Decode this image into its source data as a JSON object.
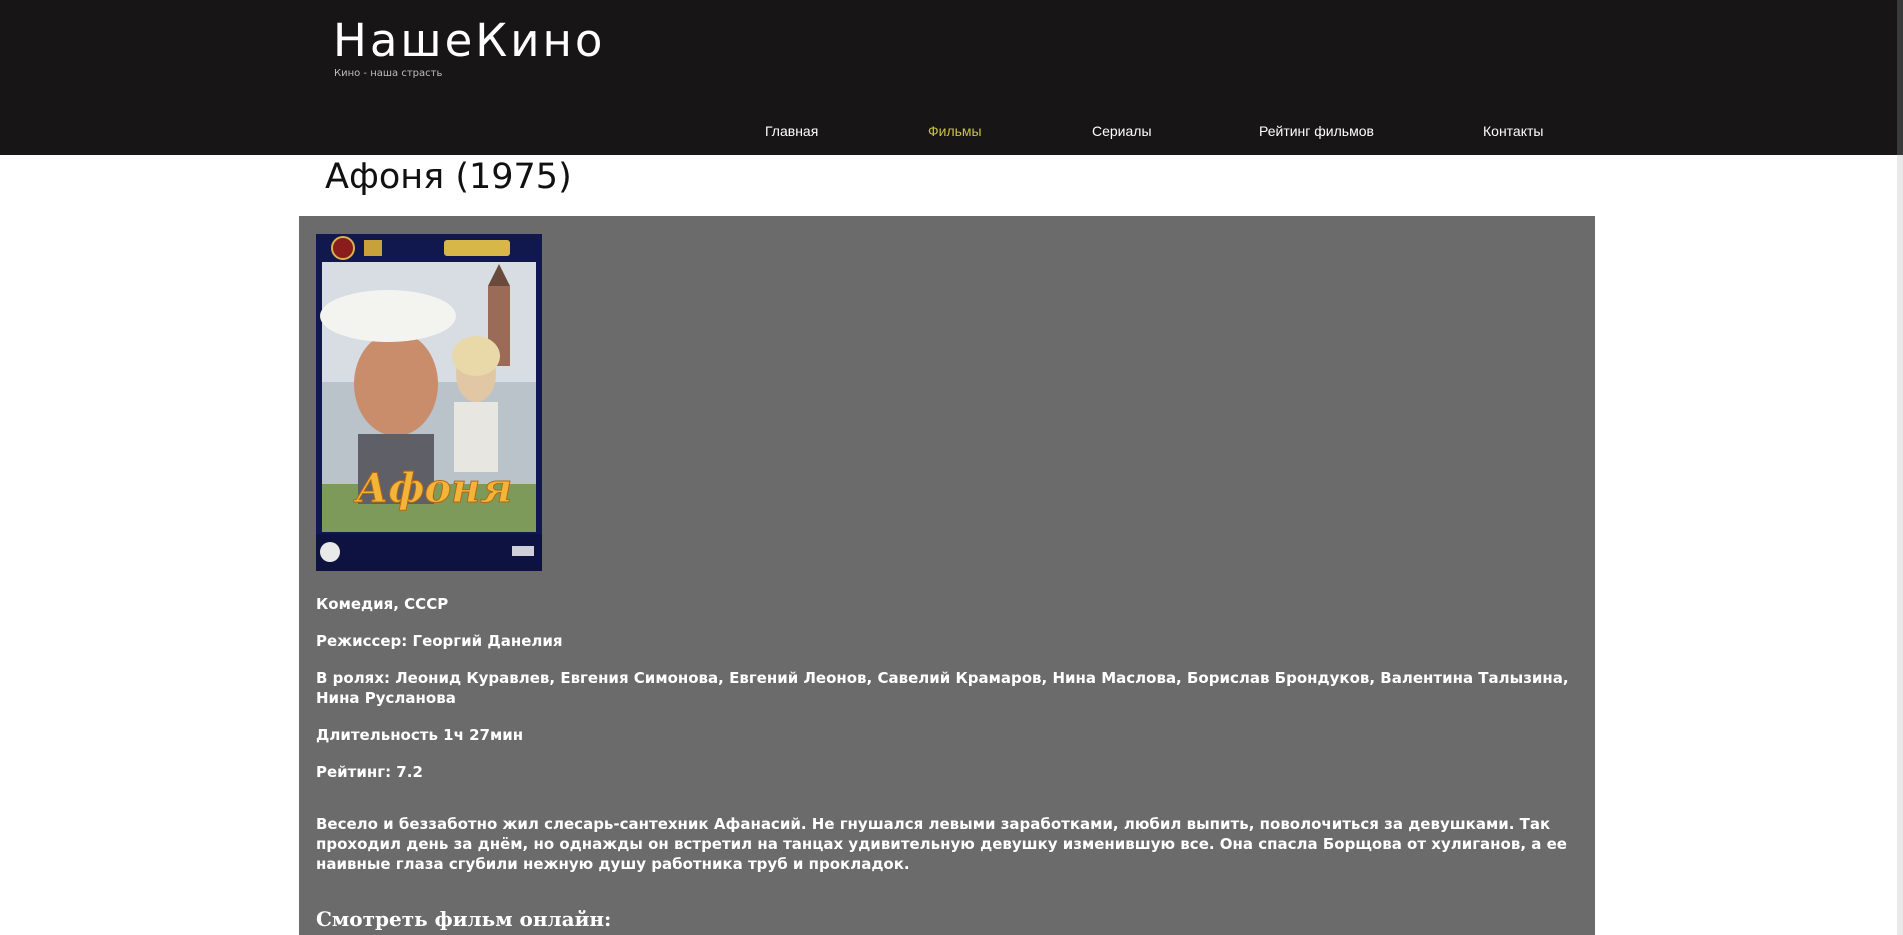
{
  "site": {
    "title": "НашеКино",
    "tagline": "Кино - наша страсть"
  },
  "nav": {
    "items": [
      {
        "label": "Главная",
        "active": false
      },
      {
        "label": "Фильмы",
        "active": true
      },
      {
        "label": "Сериалы",
        "active": false
      },
      {
        "label": "Рейтинг фильмов",
        "active": false
      },
      {
        "label": "Контакты",
        "active": false
      }
    ]
  },
  "colors": {
    "header_bg": "#171516",
    "nav_active": "#c8c247",
    "content_bg": "#6b6b6b"
  },
  "movie": {
    "title": "Афоня (1975)",
    "poster_alt": "Афоня",
    "genre": "Комедия, СССР",
    "director": "Режиссер: Георгий Данелия",
    "cast": "В ролях: Леонид Куравлев, Евгения Симонова, Евгений Леонов, Савелий Крамаров, Нина Маслова, Борислав Брондуков, Валентина Талызина, Нина Русланова",
    "duration": "Длительность 1ч 27мин",
    "rating": "Рейтинг: 7.2",
    "description": "Весело и беззаботно жил слесарь-сантехник Афанасий. Не гнушался левыми заработками, любил выпить, поволочиться за девушками. Так проходил день за днём, но однажды он встретил на танцах удивительную девушку изменившую все. Она спасла Борщова от хулиганов, а ее наивные глаза сгубили нежную душу работника труб и прокладок.",
    "watch_heading": "Смотреть фильм онлайн:"
  }
}
